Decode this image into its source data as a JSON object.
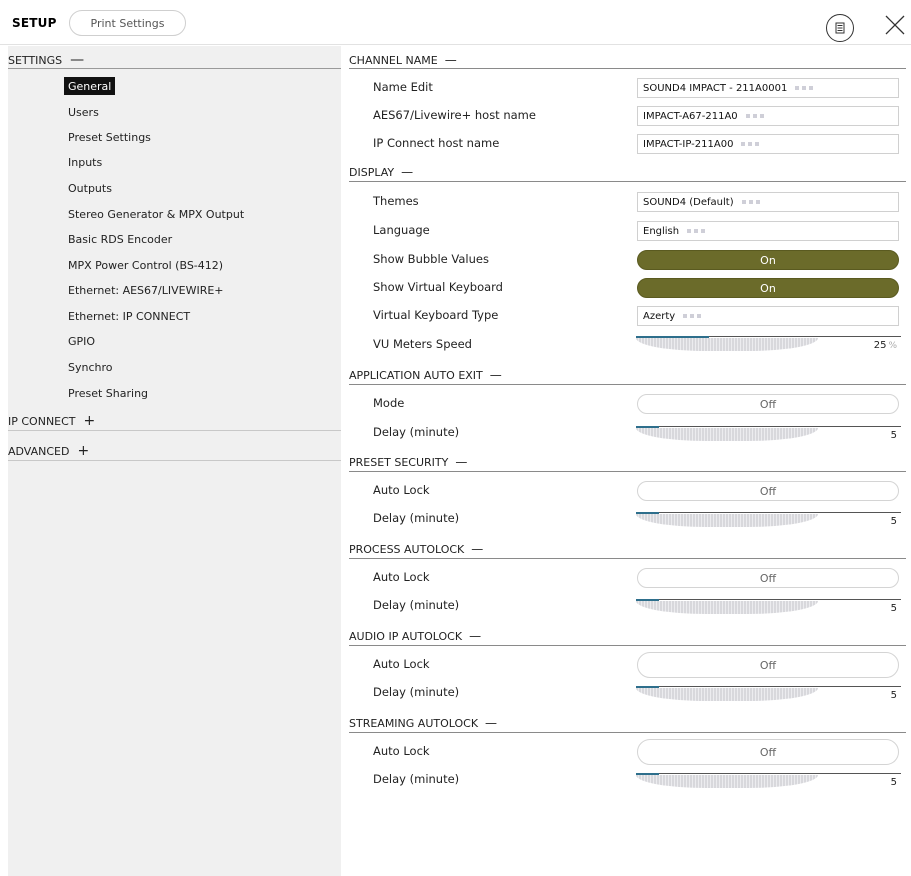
{
  "topbar": {
    "title": "SETUP",
    "print_label": "Print Settings"
  },
  "sidebar": {
    "settings": {
      "label": "SETTINGS",
      "sign": "—"
    },
    "items": [
      {
        "label": "General"
      },
      {
        "label": "Users"
      },
      {
        "label": "Preset Settings"
      },
      {
        "label": "Inputs"
      },
      {
        "label": "Outputs"
      },
      {
        "label": "Stereo Generator & MPX Output"
      },
      {
        "label": "Basic RDS Encoder"
      },
      {
        "label": "MPX Power Control (BS-412)"
      },
      {
        "label": "Ethernet: AES67/LIVEWIRE+"
      },
      {
        "label": "Ethernet: IP CONNECT"
      },
      {
        "label": "GPIO"
      },
      {
        "label": "Synchro"
      },
      {
        "label": "Preset Sharing"
      }
    ],
    "ip_connect": {
      "label": "IP CONNECT",
      "sign": "+"
    },
    "advanced": {
      "label": "ADVANCED",
      "sign": "+"
    }
  },
  "main": {
    "channel_name": {
      "title": "CHANNEL NAME",
      "sign": "—",
      "name_edit_label": "Name Edit",
      "name_edit_value": "SOUND4 IMPACT - 211A0001",
      "aes_label": "AES67/Livewire+ host name",
      "aes_value": "IMPACT-A67-211A0",
      "ip_label": "IP Connect host name",
      "ip_value": "IMPACT-IP-211A00"
    },
    "display": {
      "title": "DISPLAY",
      "sign": "—",
      "themes_label": "Themes",
      "themes_value": "SOUND4 (Default)",
      "language_label": "Language",
      "language_value": "English",
      "bubble_label": "Show Bubble Values",
      "bubble_value": "On",
      "vkb_label": "Show Virtual Keyboard",
      "vkb_value": "On",
      "vkb_type_label": "Virtual Keyboard Type",
      "vkb_type_value": "Azerty",
      "vu_label": "VU Meters Speed",
      "vu_value": "25",
      "vu_unit": "%",
      "vu_fraction": 0.25
    },
    "app_auto_exit": {
      "title": "APPLICATION AUTO EXIT",
      "sign": "—",
      "mode_label": "Mode",
      "mode_value": "Off",
      "delay_label": "Delay (minute)",
      "delay_value": "5",
      "delay_fraction": 0.08
    },
    "preset_security": {
      "title": "PRESET SECURITY",
      "sign": "—",
      "lock_label": "Auto Lock",
      "lock_value": "Off",
      "delay_label": "Delay (minute)",
      "delay_value": "5",
      "delay_fraction": 0.08
    },
    "process_autolock": {
      "title": "PROCESS AUTOLOCK",
      "sign": "—",
      "lock_label": "Auto Lock",
      "lock_value": "Off",
      "delay_label": "Delay (minute)",
      "delay_value": "5",
      "delay_fraction": 0.08
    },
    "audio_ip_autolock": {
      "title": "AUDIO IP AUTOLOCK",
      "sign": "—",
      "lock_label": "Auto Lock",
      "lock_value": "Off",
      "delay_label": "Delay (minute)",
      "delay_value": "5",
      "delay_fraction": 0.08
    },
    "streaming_autolock": {
      "title": "STREAMING AUTOLOCK",
      "sign": "—",
      "lock_label": "Auto Lock",
      "lock_value": "Off",
      "delay_label": "Delay (minute)",
      "delay_value": "5",
      "delay_fraction": 0.08
    }
  },
  "colors": {
    "toggle_on": "#6b6b2a",
    "slider_fill": "#2e6f8c",
    "sidebar_bg": "#f0f0f0"
  },
  "icons": {
    "menu": "list-circle-icon",
    "close": "close-icon"
  }
}
